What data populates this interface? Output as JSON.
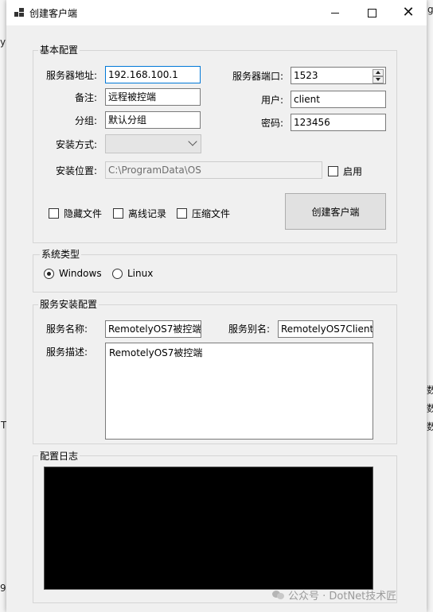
{
  "background": {
    "left_fragments": [
      "y",
      "T",
      "9"
    ],
    "right_fragments": [
      "g",
      "数",
      "数",
      "数"
    ]
  },
  "window": {
    "title": "创建客户端",
    "controls": {
      "minimize": "minimize-icon",
      "maximize": "maximize-icon",
      "close": "close-icon"
    }
  },
  "basic": {
    "group_title": "基本配置",
    "server_address_label": "服务器地址:",
    "server_address_value": "192.168.100.1",
    "server_port_label": "服务器端口:",
    "server_port_value": "1523",
    "remark_label": "备注:",
    "remark_value": "远程被控端",
    "user_label": "用户:",
    "user_value": "client",
    "group_label": "分组:",
    "group_value": "默认分组",
    "password_label": "密码:",
    "password_value": "123456",
    "install_method_label": "安装方式:",
    "install_method_value": "",
    "install_location_label": "安装位置:",
    "install_location_value": "C:\\ProgramData\\OS",
    "enable_label": "启用",
    "hide_file_label": "隐藏文件",
    "offline_log_label": "离线记录",
    "compress_file_label": "压缩文件",
    "create_button_label": "创建客户端"
  },
  "system_type": {
    "group_title": "系统类型",
    "options": [
      {
        "label": "Windows",
        "selected": true
      },
      {
        "label": "Linux",
        "selected": false
      }
    ]
  },
  "service": {
    "group_title": "服务安装配置",
    "name_label": "服务名称:",
    "name_value": "RemotelyOS7被控端",
    "alias_label": "服务别名:",
    "alias_value": "RemotelyOS7Client",
    "desc_label": "服务描述:",
    "desc_value": "RemotelyOS7被控端"
  },
  "log": {
    "group_title": "配置日志"
  },
  "watermark": {
    "text": "公众号 · DotNet技术匠"
  },
  "colors": {
    "focus_border": "#0078d7",
    "log_background": "#000000",
    "window_background": "#f0f0f0"
  }
}
